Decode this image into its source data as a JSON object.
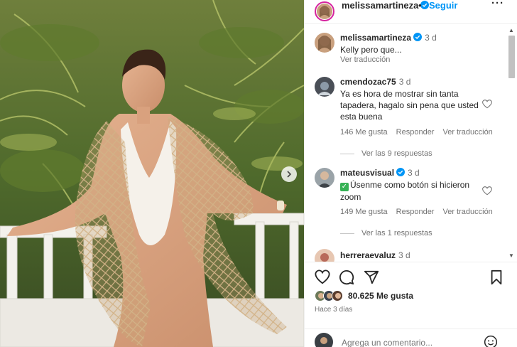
{
  "post": {
    "author": "melissamartineza",
    "separator": "•",
    "follow_label": "Seguir",
    "more_label": "···"
  },
  "comments": [
    {
      "user": "melissamartineza",
      "time": "3 d",
      "text": "Kelly pero que...",
      "translate": "Ver traducción"
    },
    {
      "user": "cmendozac75",
      "time": "3 d",
      "text": "Ya es hora de mostrar sin tanta tapadera, hagalo sin pena que usted esta buena",
      "likes": "146 Me gusta",
      "reply": "Responder",
      "translate": "Ver traducción",
      "replies": "Ver las 9 respuestas"
    },
    {
      "user": "mateusvisual",
      "time": "3 d",
      "text": "Úsenme como botón si hicieron zoom",
      "likes": "149 Me gusta",
      "reply": "Responder",
      "translate": "Ver traducción",
      "replies": "Ver las 1 respuestas"
    },
    {
      "user": "herreraevaluz",
      "time": "3 d"
    }
  ],
  "footer": {
    "likes_count": "80.625 Me gusta",
    "posted": "Hace 3 días",
    "comment_placeholder": "Agrega un comentario..."
  },
  "colors": {
    "accent": "#0095f6",
    "verified": "#0095f6",
    "muted": "#737373",
    "emoji_check": "#36b255"
  },
  "icons": {
    "like": "heart-icon",
    "comment": "comment-icon",
    "share": "paper-plane-icon",
    "save": "bookmark-icon",
    "next": "chevron-right-icon",
    "emoji": "smiley-icon"
  }
}
